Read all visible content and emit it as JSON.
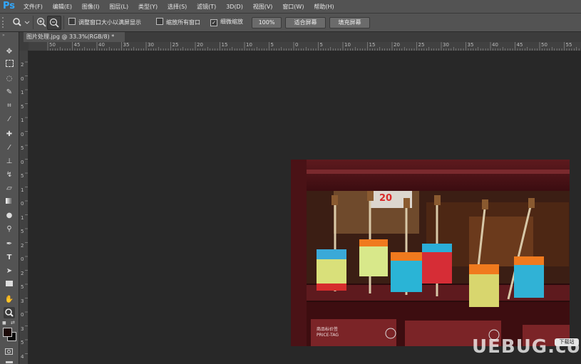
{
  "app": {
    "logo": "Ps"
  },
  "menu": [
    "文件(F)",
    "编辑(E)",
    "图像(I)",
    "图层(L)",
    "类型(Y)",
    "选择(S)",
    "滤镜(T)",
    "3D(D)",
    "视图(V)",
    "窗口(W)",
    "帮助(H)"
  ],
  "options": {
    "resize_windows": "调整窗口大小以满屏显示",
    "zoom_all": "缩放所有窗口",
    "scrubby_zoom": "细微缩放",
    "btn_100": "100%",
    "btn_fit": "适合屏幕",
    "btn_fill": "填充屏幕"
  },
  "document": {
    "tab_title": "图片处理.jpg @ 33.3%(RGB/8) *",
    "close": "×"
  },
  "ruler_h": [
    "50",
    "45",
    "40",
    "35",
    "30",
    "25",
    "20",
    "15",
    "10",
    "5",
    "0",
    "5",
    "10",
    "15",
    "20",
    "25",
    "30",
    "35",
    "40",
    "45",
    "50",
    "55"
  ],
  "ruler_v": [
    "2",
    "0",
    "1",
    "5",
    "1",
    "0",
    "5",
    "0",
    "5",
    "1",
    "0",
    "1",
    "5",
    "2",
    "0",
    "2",
    "5",
    "3",
    "0",
    "3",
    "5",
    "4"
  ],
  "photo": {
    "price_sign": "20",
    "tag_text_1": "商品标价签",
    "tag_text_2": "PRICE-TAG"
  },
  "watermark": {
    "text": "UEBUG.com",
    "badge": "下载站"
  },
  "colors": {
    "ps_blue": "#31a8ff",
    "ui_gray": "#535353",
    "canvas": "#282828"
  }
}
